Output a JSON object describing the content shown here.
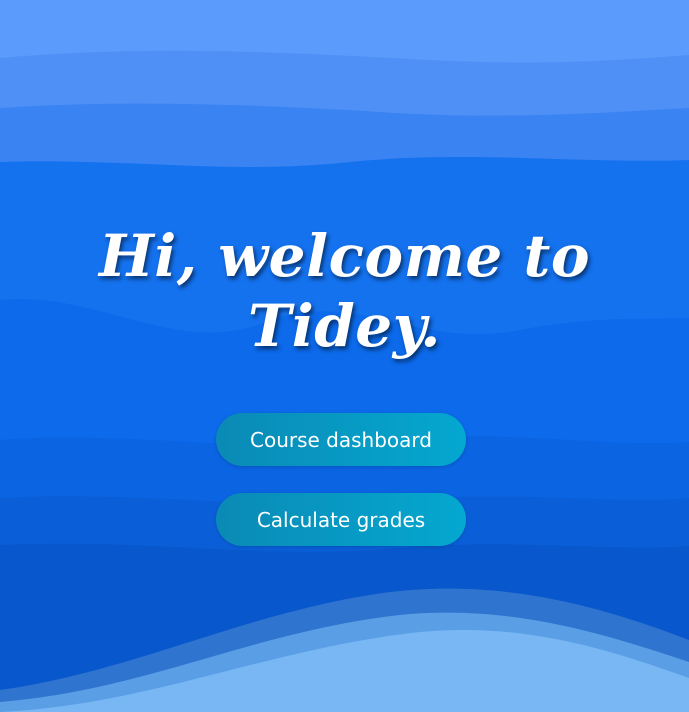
{
  "hero": {
    "title": "Hi, welcome to Tidey."
  },
  "actions": {
    "course_dashboard_label": "Course dashboard",
    "calculate_grades_label": "Calculate grades"
  },
  "colors": {
    "sky": "#5b9bfb",
    "deep_blue": "#0b66e4",
    "button_gradient_start": "#0a8ab5",
    "button_gradient_end": "#04a8d0",
    "foam": "#78b7f4"
  }
}
